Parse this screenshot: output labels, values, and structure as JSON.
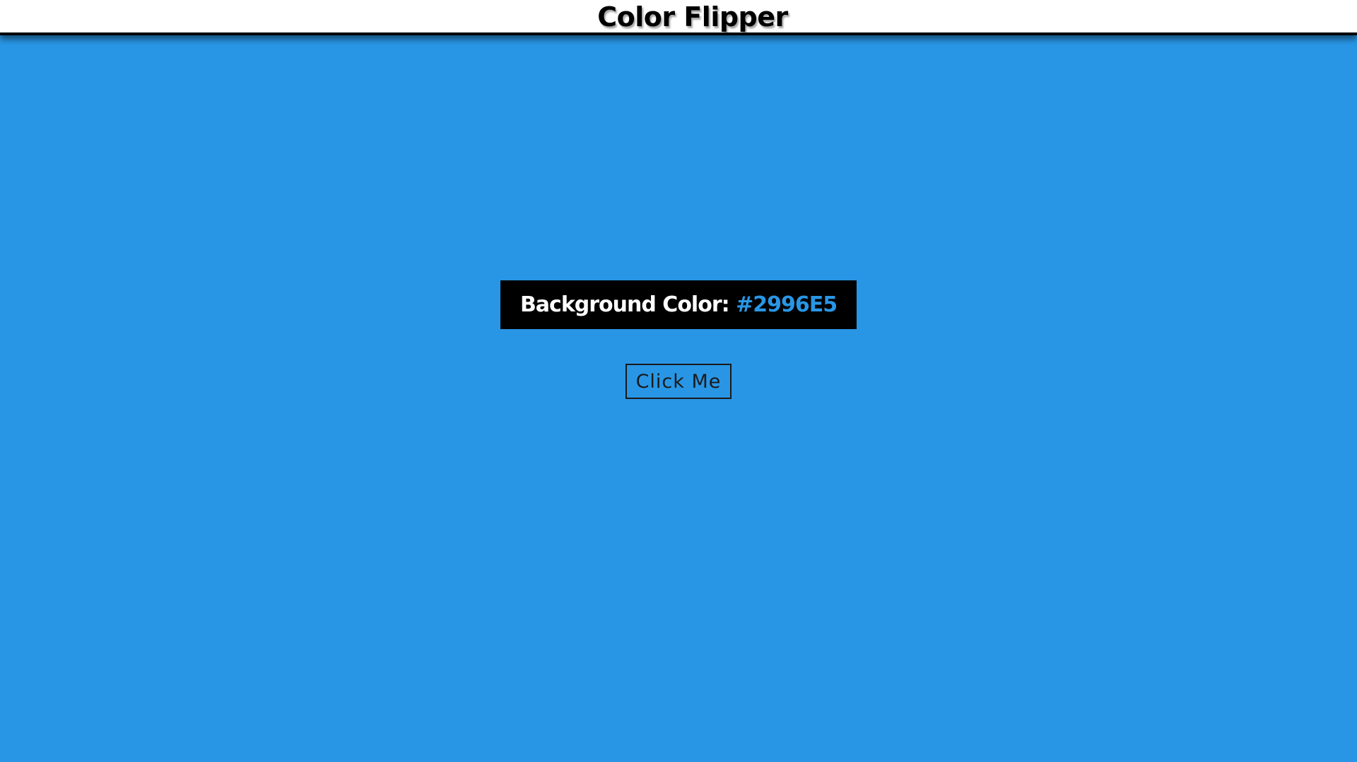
{
  "header": {
    "title": "Color Flipper"
  },
  "panel": {
    "label": "Background Color:",
    "value": "#2996E5"
  },
  "button": {
    "label": "Click Me"
  },
  "colors": {
    "background": "#2996E5",
    "header_bg": "#ffffff",
    "panel_bg": "#000000",
    "text_dark": "#000000",
    "text_light": "#ffffff"
  }
}
